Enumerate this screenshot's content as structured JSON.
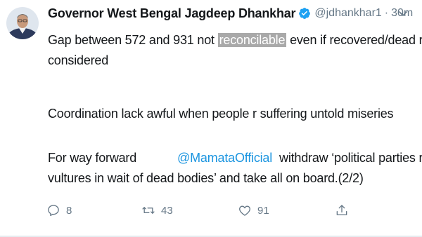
{
  "author": {
    "name": "Governor West Bengal Jagdeep Dhankhar",
    "handle": "@jdhankhar1",
    "separator": "·",
    "time": "30m"
  },
  "tweet": {
    "line1_pre": "Gap between 572 and 931 not ",
    "line1_highlight": "reconcilable",
    "line1_post": " even if recovered/dead r",
    "line2": "considered",
    "line3": "Coordination lack awful when people r suffering untold miseries",
    "line4_pre": "For way forward",
    "line4_mention": "@MamataOfficial",
    "line4_post": "withdraw ‘political parties r",
    "line5": "vultures in wait of dead bodies’ and take all on board.(2/2)"
  },
  "actions": {
    "replies": "8",
    "retweets": "43",
    "likes": "91"
  },
  "icons": {
    "verified": "verified-badge-icon",
    "reply": "reply-icon",
    "retweet": "retweet-icon",
    "like": "like-icon",
    "share": "share-icon",
    "more": "chevron-down-icon"
  },
  "colors": {
    "text": "#14171a",
    "secondary": "#657786",
    "link": "#1b95e0",
    "verified": "#1da1f2",
    "highlight": "#a9a9a9"
  }
}
